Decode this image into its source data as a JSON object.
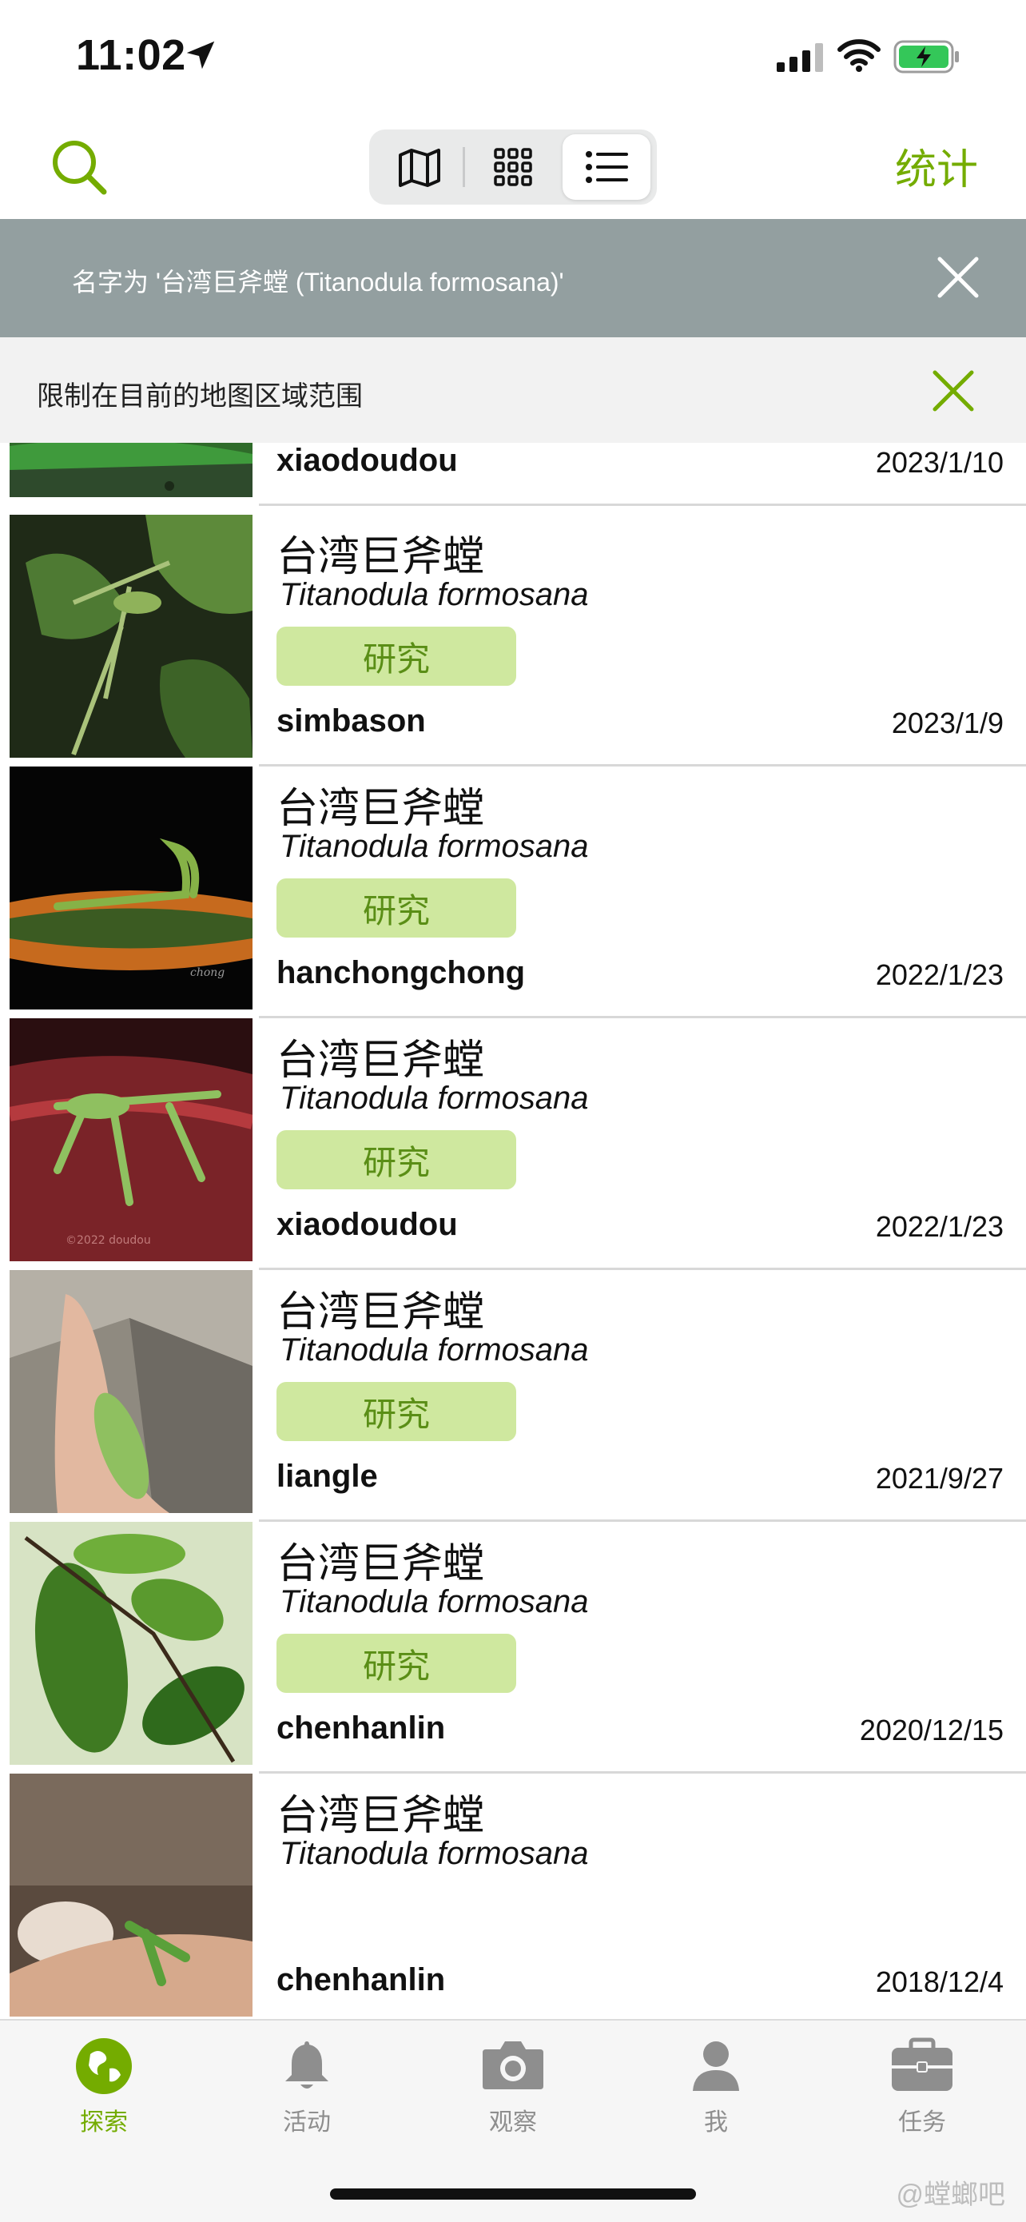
{
  "status_bar": {
    "time": "11:02"
  },
  "nav": {
    "stats_label": "统计",
    "view_modes": [
      "map-icon",
      "grid-icon",
      "list-icon"
    ],
    "active_view": "list"
  },
  "filter": {
    "text": "名字为 '台湾巨斧螳 (Titanodula formosana)'"
  },
  "restrict": {
    "text": "限制在目前的地图区域范围"
  },
  "observations": [
    {
      "user": "xiaodoudou",
      "date": "2023/1/10"
    },
    {
      "common_name": "台湾巨斧螳",
      "scientific_name": "Titanodula formosana",
      "badge": "研究",
      "user": "simbason",
      "date": "2023/1/9"
    },
    {
      "common_name": "台湾巨斧螳",
      "scientific_name": "Titanodula formosana",
      "badge": "研究",
      "user": "hanchongchong",
      "date": "2022/1/23",
      "photo_caption": "chong"
    },
    {
      "common_name": "台湾巨斧螳",
      "scientific_name": "Titanodula formosana",
      "badge": "研究",
      "user": "xiaodoudou",
      "date": "2022/1/23",
      "photo_caption": "©2022 doudou"
    },
    {
      "common_name": "台湾巨斧螳",
      "scientific_name": "Titanodula formosana",
      "badge": "研究",
      "user": "liangle",
      "date": "2021/9/27"
    },
    {
      "common_name": "台湾巨斧螳",
      "scientific_name": "Titanodula formosana",
      "badge": "研究",
      "user": "chenhanlin",
      "date": "2020/12/15"
    },
    {
      "common_name": "台湾巨斧螳",
      "scientific_name": "Titanodula formosana",
      "user": "chenhanlin",
      "date": "2018/12/4"
    }
  ],
  "tabs": [
    {
      "label": "探索",
      "icon": "globe-icon",
      "active": true
    },
    {
      "label": "活动",
      "icon": "bell-icon"
    },
    {
      "label": "观察",
      "icon": "camera-icon"
    },
    {
      "label": "我",
      "icon": "person-icon"
    },
    {
      "label": "任务",
      "icon": "briefcase-icon"
    }
  ],
  "watermark": "@螳螂吧",
  "colors": {
    "accent": "#74ac00",
    "banner": "#939fa0",
    "badge_bg": "#cfe89f",
    "badge_text": "#5a8e16"
  }
}
